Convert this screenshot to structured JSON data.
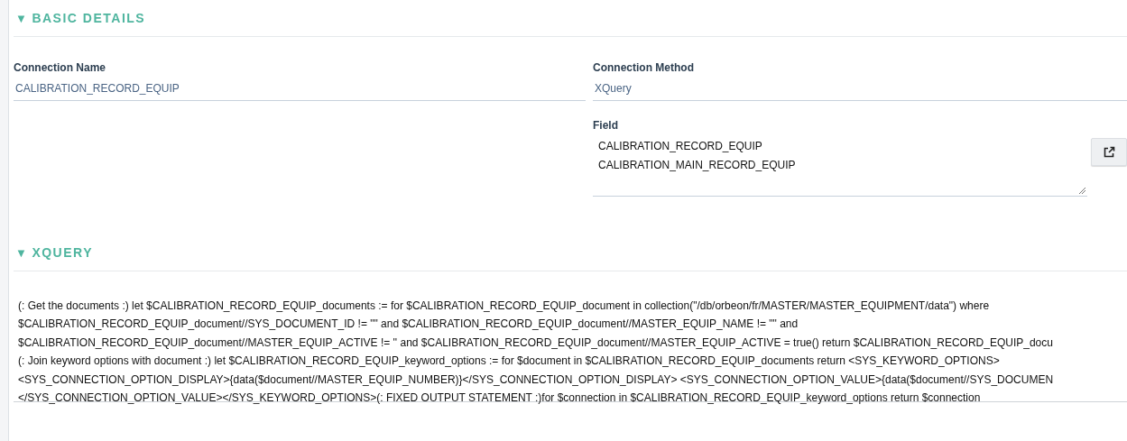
{
  "sections": [
    {
      "kind": "details",
      "toggle": "▼",
      "title": "BASIC DETAILS",
      "connection_name": {
        "label": "Connection Name",
        "value": "CALIBRATION_RECORD_EQUIP"
      },
      "connection_method": {
        "label": "Connection Method",
        "value": "XQuery"
      },
      "field": {
        "label": "Field",
        "lines": [
          "CALIBRATION_RECORD_EQUIP",
          "CALIBRATION_MAIN_RECORD_EQUIP"
        ]
      }
    },
    {
      "kind": "code",
      "toggle": "▼",
      "title": "XQUERY",
      "lines": [
        "(: Get the documents :) let $CALIBRATION_RECORD_EQUIP_documents := for $CALIBRATION_RECORD_EQUIP_document in  collection(\"/db/orbeon/fr/MASTER/MASTER_EQUIPMENT/data\") where",
        "$CALIBRATION_RECORD_EQUIP_document//SYS_DOCUMENT_ID != \"\"  and $CALIBRATION_RECORD_EQUIP_document//MASTER_EQUIP_NAME != \"\" and",
        "$CALIBRATION_RECORD_EQUIP_document//MASTER_EQUIP_ACTIVE != '' and $CALIBRATION_RECORD_EQUIP_document//MASTER_EQUIP_ACTIVE = true()  return $CALIBRATION_RECORD_EQUIP_docu",
        "(: Join keyword options with document :) let $CALIBRATION_RECORD_EQUIP_keyword_options := for $document in $CALIBRATION_RECORD_EQUIP_documents return <SYS_KEYWORD_OPTIONS>",
        "<SYS_CONNECTION_OPTION_DISPLAY>{data($document//MASTER_EQUIP_NUMBER)}</SYS_CONNECTION_OPTION_DISPLAY> <SYS_CONNECTION_OPTION_VALUE>{data($document//SYS_DOCUMEN",
        "</SYS_CONNECTION_OPTION_VALUE></SYS_KEYWORD_OPTIONS>(: FIXED OUTPUT STATEMENT :)for $connection in $CALIBRATION_RECORD_EQUIP_keyword_options return $connection"
      ]
    }
  ]
}
